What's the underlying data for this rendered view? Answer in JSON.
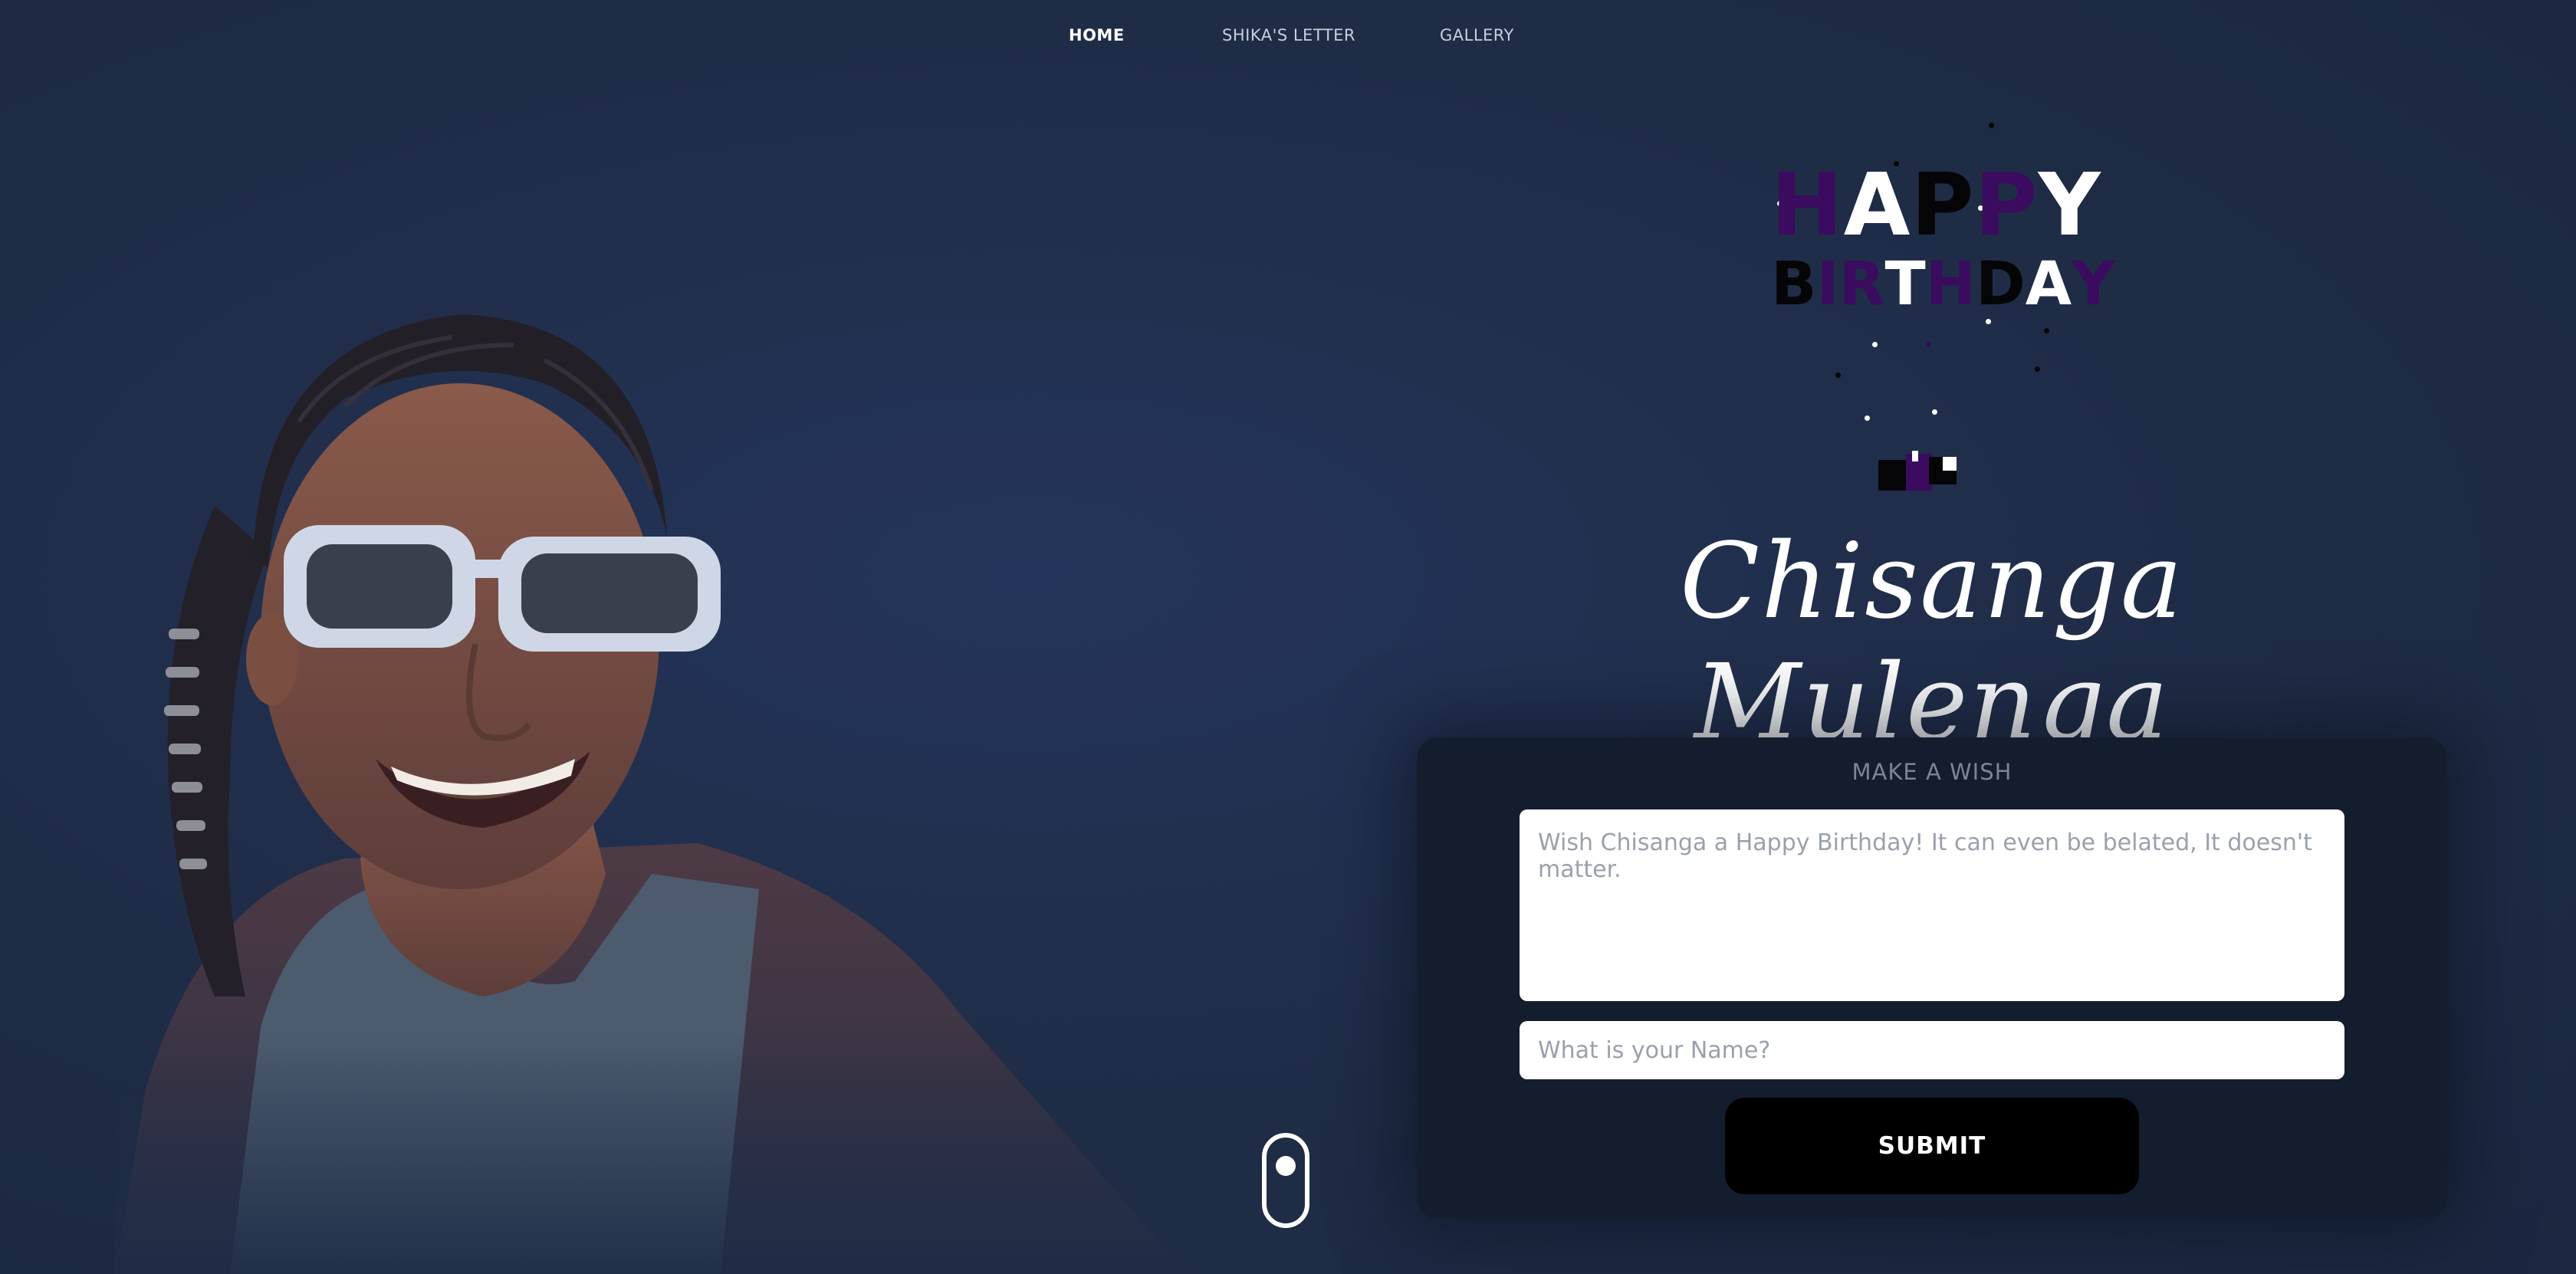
{
  "nav": {
    "items": [
      {
        "label": "HOME",
        "active": true
      },
      {
        "label": "SHIKA'S LETTER",
        "active": false
      },
      {
        "label": "GALLERY",
        "active": false
      }
    ]
  },
  "hero": {
    "title_line1": "HAPPY",
    "title_line2": "BIRTHDAY",
    "name": "Chisanga Mulenga"
  },
  "wish_form": {
    "heading": "MAKE A WISH",
    "message_placeholder": "Wish Chisanga a Happy Birthday! It can even be belated, It doesn't matter.",
    "message_value": "",
    "name_placeholder": "What is your Name?",
    "name_value": "",
    "submit_label": "SUBMIT"
  },
  "colors": {
    "background": "#1f2c46",
    "card": "#131d2e",
    "accent_purple": "#3a0b5e",
    "button": "#000000"
  }
}
